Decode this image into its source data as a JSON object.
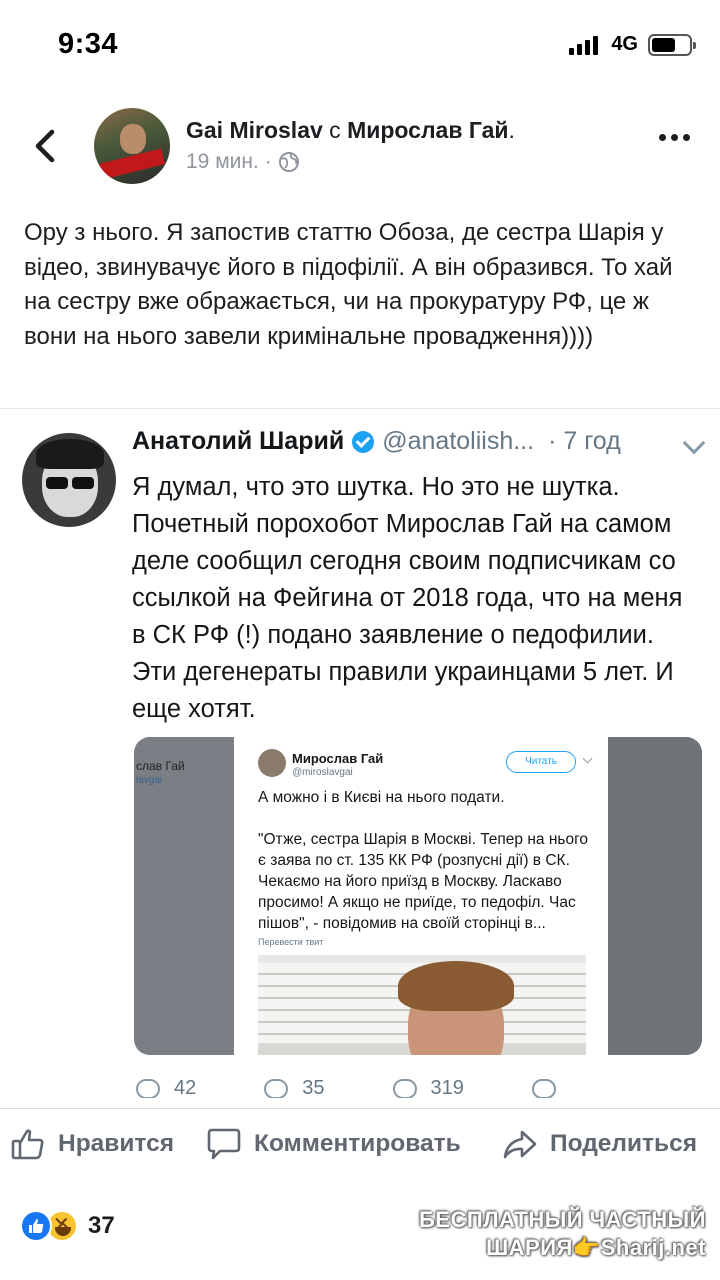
{
  "status_bar": {
    "time": "9:34",
    "network": "4G",
    "signal_bars_filled": 4,
    "battery_level": 0.65
  },
  "post": {
    "author": "Gai Miroslav",
    "with_word": "с",
    "tagged": "Мирослав Гай",
    "tagged_suffix": ".",
    "time_ago": "19 мин.",
    "privacy_icon": "globe-icon",
    "text": "Ору з нього. Я запостив статтю Обоза, де сестра Шарія у відео, звинувачує його в підофілії. А він образився. То хай на сестру вже ображається, чи на прокуратуру РФ,  це ж вони на нього завели кримінальне провадження))))"
  },
  "tweet": {
    "name": "Анатолий Шарий",
    "handle": "@anatoliish...",
    "time": "· 7 год",
    "text": "Я думал, что это шутка. Но это не шутка. Почетный порохобот Мирослав Гай на самом деле сообщил сегодня своим подписчикам со ссылкой на Фейгина от 2018 года, что на меня в СК РФ (!) подано заявление о педофилии. Эти дегенераты правили украинцами 5 лет. И еще хотят.",
    "embedded": {
      "left_name": "слав Гай",
      "left_handle": "lavgai",
      "name": "Мирослав Гай",
      "handle": "@miroslavgai",
      "follow_label": "Читать",
      "text": "А можно і в Києві на нього подати.\n\n\"Отже, сестра Шарія в Москві. Тепер на нього є заява по ст. 135 КК РФ (розпусні дії) в СК. Чекаємо на його приїзд в Москву. Ласкаво просимо! А якщо не приїде, то педофіл. Час пішов\", - повідомив на своїй сторінці в...",
      "translate_label": "Перевести твит"
    },
    "actions": {
      "replies": "42",
      "retweets": "35",
      "likes": "319"
    }
  },
  "action_bar": {
    "like_label": "Нравится",
    "comment_label": "Комментировать",
    "share_label": "Поделиться"
  },
  "reactions": {
    "count": "37",
    "types": [
      "like",
      "haha"
    ]
  },
  "watermark": {
    "line1": "БЕСПЛАТНЫЙ ЧАСТНЫЙ",
    "line2": "ШАРИЯ👉Sharij.net"
  },
  "colors": {
    "facebook_blue": "#1877f2",
    "twitter_blue": "#1da1f2",
    "text_gray": "#606770"
  }
}
